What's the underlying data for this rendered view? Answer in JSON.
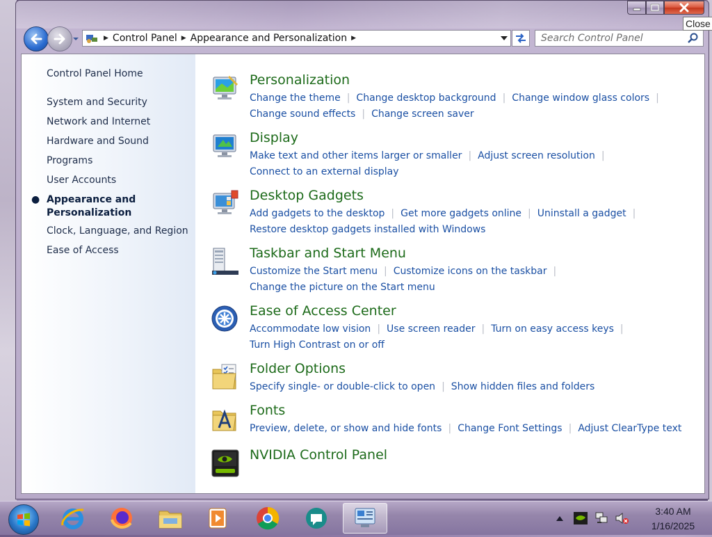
{
  "window": {
    "close_tooltip": "Close"
  },
  "address": {
    "crumbs": [
      "Control Panel",
      "Appearance and Personalization"
    ]
  },
  "search": {
    "placeholder": "Search Control Panel"
  },
  "sidebar": {
    "home": "Control Panel Home",
    "items": [
      {
        "label": "System and Security",
        "active": false
      },
      {
        "label": "Network and Internet",
        "active": false
      },
      {
        "label": "Hardware and Sound",
        "active": false
      },
      {
        "label": "Programs",
        "active": false
      },
      {
        "label": "User Accounts",
        "active": false
      },
      {
        "label": "Appearance and Personalization",
        "active": true
      },
      {
        "label": "Clock, Language, and Region",
        "active": false
      },
      {
        "label": "Ease of Access",
        "active": false
      }
    ]
  },
  "categories": [
    {
      "title": "Personalization",
      "icon": "personalization-icon",
      "links": [
        "Change the theme",
        "Change desktop background",
        "Change window glass colors",
        "Change sound effects",
        "Change screen saver"
      ]
    },
    {
      "title": "Display",
      "icon": "display-icon",
      "links": [
        "Make text and other items larger or smaller",
        "Adjust screen resolution",
        "Connect to an external display"
      ]
    },
    {
      "title": "Desktop Gadgets",
      "icon": "gadgets-icon",
      "links": [
        "Add gadgets to the desktop",
        "Get more gadgets online",
        "Uninstall a gadget",
        "Restore desktop gadgets installed with Windows"
      ]
    },
    {
      "title": "Taskbar and Start Menu",
      "icon": "taskbar-icon",
      "links": [
        "Customize the Start menu",
        "Customize icons on the taskbar",
        "Change the picture on the Start menu"
      ]
    },
    {
      "title": "Ease of Access Center",
      "icon": "ease-of-access-icon",
      "links": [
        "Accommodate low vision",
        "Use screen reader",
        "Turn on easy access keys",
        "Turn High Contrast on or off"
      ]
    },
    {
      "title": "Folder Options",
      "icon": "folder-options-icon",
      "links": [
        "Specify single- or double-click to open",
        "Show hidden files and folders"
      ]
    },
    {
      "title": "Fonts",
      "icon": "fonts-icon",
      "links": [
        "Preview, delete, or show and hide fonts",
        "Change Font Settings",
        "Adjust ClearType text"
      ]
    },
    {
      "title": "NVIDIA Control Panel",
      "icon": "nvidia-icon",
      "links": []
    }
  ],
  "taskbar": {
    "apps": [
      "internet-explorer-icon",
      "firefox-icon",
      "file-explorer-icon",
      "media-player-icon",
      "chrome-icon",
      "chat-app-icon",
      "control-panel-icon"
    ],
    "active_app": "control-panel-icon",
    "time": "3:40 AM",
    "date": "1/16/2025"
  },
  "colors": {
    "link": "#1a4fa3",
    "category_title": "#1c6a19",
    "sidebar_text": "#1e2d4a"
  }
}
